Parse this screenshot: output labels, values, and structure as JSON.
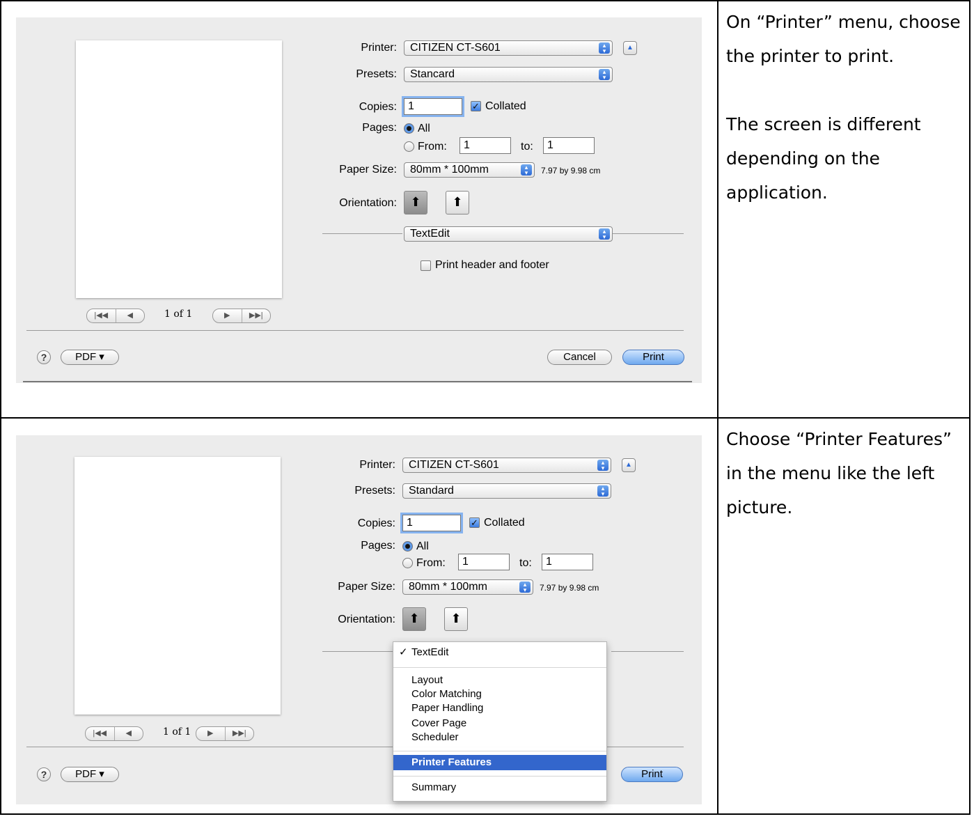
{
  "steps": [
    {
      "instructions": [
        "On “Printer” menu, choose the printer to print.",
        "The screen is different depending on the application."
      ],
      "dialog": {
        "printer_label": "Printer:",
        "printer_value": "CITIZEN CT-S601",
        "presets_label": "Presets:",
        "presets_value": "Stancard",
        "copies_label": "Copies:",
        "copies_value": "1",
        "collated_label": "Collated",
        "pages_label": "Pages:",
        "all_label": "All",
        "from_label": "From:",
        "from_value": "1",
        "to_label": "to:",
        "to_value": "1",
        "paper_size_label": "Paper Size:",
        "paper_size_value": "80mm * 100mm",
        "paper_dims": "7.97 by 9.98 cm",
        "orientation_label": "Orientation:",
        "app_menu_value": "TextEdit",
        "header_footer_label": "Print header and footer",
        "page_count": "1 of 1",
        "pdf_label": "PDF ▾",
        "cancel_label": "Cancel",
        "print_label": "Print"
      }
    },
    {
      "instructions": [
        "Choose “Printer Features” in the menu like the left picture."
      ],
      "dialog": {
        "printer_label": "Printer:",
        "printer_value": "CITIZEN CT-S601",
        "presets_label": "Presets:",
        "presets_value": "Standard",
        "copies_label": "Copies:",
        "copies_value": "1",
        "collated_label": "Collated",
        "pages_label": "Pages:",
        "all_label": "All",
        "from_label": "From:",
        "from_value": "1",
        "to_label": "to:",
        "to_value": "1",
        "paper_size_label": "Paper Size:",
        "paper_size_value": "80mm * 100mm",
        "paper_dims": "7.97 by 9.98 cm",
        "orientation_label": "Orientation:",
        "page_count": "1 of 1",
        "pdf_label": "PDF ▾",
        "print_label": "Print",
        "menu": {
          "checked_item": "TextEdit",
          "items": [
            "Layout",
            "Color Matching",
            "Paper Handling",
            "Cover Page",
            "Scheduler"
          ],
          "highlighted_item": "Printer Features",
          "last_item": "Summary"
        }
      }
    }
  ],
  "icons": {
    "help": "help-icon",
    "arrows": "popup-arrows-icon",
    "disclosure": "disclosure-triangle-icon",
    "portrait": "portrait-orientation-icon",
    "landscape": "landscape-orientation-icon",
    "first_page": "first-page-icon",
    "prev_page": "previous-page-icon",
    "next_page": "next-page-icon",
    "last_page": "last-page-icon"
  },
  "colors": {
    "dialog_bg": "#ececec",
    "accent_blue": "#3366cc",
    "focus_ring": "#86b3ef"
  }
}
